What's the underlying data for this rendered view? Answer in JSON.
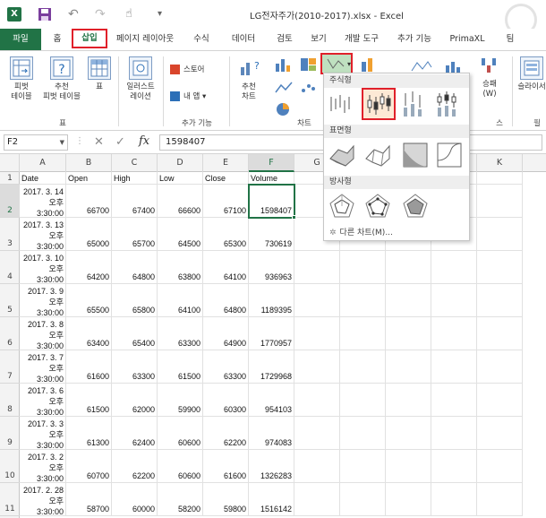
{
  "window": {
    "title": "LG전자주가(2010-2017).xlsx - Excel",
    "app_logo": "X"
  },
  "tabs": [
    {
      "label": "파일",
      "name": "tab-file"
    },
    {
      "label": "홈",
      "name": "tab-home"
    },
    {
      "label": "삽입",
      "name": "tab-insert"
    },
    {
      "label": "페이지 레이아웃",
      "name": "tab-page-layout"
    },
    {
      "label": "수식",
      "name": "tab-formulas"
    },
    {
      "label": "데이터",
      "name": "tab-data"
    },
    {
      "label": "검토",
      "name": "tab-review"
    },
    {
      "label": "보기",
      "name": "tab-view"
    },
    {
      "label": "개발 도구",
      "name": "tab-developer"
    },
    {
      "label": "추가 기능",
      "name": "tab-addins"
    },
    {
      "label": "PrimaXL",
      "name": "tab-primaxl"
    },
    {
      "label": "팀",
      "name": "tab-team"
    }
  ],
  "ribbon": {
    "pivot_table": "피벗\n테이블",
    "recommended_pivot": "추천\n피벗 테이블",
    "table": "표",
    "table_group": "표",
    "illustrations": "일러스트\n레이션",
    "store": "스토어",
    "my_apps": "내 앱",
    "addins_group": "추가 기능",
    "recommended_charts": "추천\n차트",
    "charts_group": "차트",
    "winloss": "승패\n(W)",
    "sparkline_group": "스",
    "slicer": "슬라이서",
    "filter_group": "필"
  },
  "formula_bar": {
    "name_box": "F2",
    "value": "1598407"
  },
  "columns": [
    "A",
    "B",
    "C",
    "D",
    "E",
    "F",
    "G",
    "H",
    "I",
    "J",
    "K"
  ],
  "selected_column": "F",
  "header_row": [
    "Date",
    "Open",
    "High",
    "Low",
    "Close",
    "Volume"
  ],
  "rows": [
    {
      "date": "2017. 3. 14",
      "ampm": "오후",
      "time": "3:30:00",
      "open": "66700",
      "high": "67400",
      "low": "66600",
      "close": "67100",
      "volume": "1598407"
    },
    {
      "date": "2017. 3. 13",
      "ampm": "오후",
      "time": "3:30:00",
      "open": "65000",
      "high": "65700",
      "low": "64500",
      "close": "65300",
      "volume": "730619"
    },
    {
      "date": "2017. 3. 10",
      "ampm": "오후",
      "time": "3:30:00",
      "open": "64200",
      "high": "64800",
      "low": "63800",
      "close": "64100",
      "volume": "936963"
    },
    {
      "date": "2017. 3. 9",
      "ampm": "오후",
      "time": "3:30:00",
      "open": "65500",
      "high": "65800",
      "low": "64100",
      "close": "64800",
      "volume": "1189395"
    },
    {
      "date": "2017. 3. 8",
      "ampm": "오후",
      "time": "3:30:00",
      "open": "63400",
      "high": "65400",
      "low": "63300",
      "close": "64900",
      "volume": "1770957"
    },
    {
      "date": "2017. 3. 7",
      "ampm": "오후",
      "time": "3:30:00",
      "open": "61600",
      "high": "63300",
      "low": "61500",
      "close": "63300",
      "volume": "1729968"
    },
    {
      "date": "2017. 3. 6",
      "ampm": "오후",
      "time": "3:30:00",
      "open": "61500",
      "high": "62000",
      "low": "59900",
      "close": "60300",
      "volume": "954103"
    },
    {
      "date": "2017. 3. 3",
      "ampm": "오후",
      "time": "3:30:00",
      "open": "61300",
      "high": "62400",
      "low": "60600",
      "close": "62200",
      "volume": "974083"
    },
    {
      "date": "2017. 3. 2",
      "ampm": "오후",
      "time": "3:30:00",
      "open": "60700",
      "high": "62200",
      "low": "60600",
      "close": "61600",
      "volume": "1326283"
    },
    {
      "date": "2017. 2. 28",
      "ampm": "오후",
      "time": "3:30:00",
      "open": "58700",
      "high": "60000",
      "low": "58200",
      "close": "59800",
      "volume": "1516142"
    }
  ],
  "dropdown": {
    "stock_section": "주식형",
    "surface_section": "표면형",
    "radar_section": "방사형",
    "more_charts": "다른 차트(M)..."
  },
  "colors": {
    "excel_green": "#217346",
    "highlight_red": "#e0202a"
  }
}
